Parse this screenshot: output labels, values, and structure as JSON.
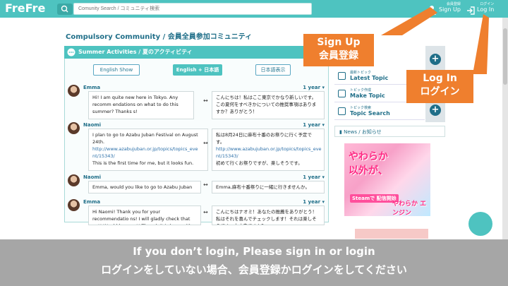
{
  "app": {
    "logo": "FreFre"
  },
  "search": {
    "placeholder": "Comunity Search / コミュニティ検索"
  },
  "nav": {
    "signup_small": "会員登録",
    "signup_label": "Sign Up",
    "login_small": "ログイン",
    "login_label": "Log In"
  },
  "community": {
    "title": "Compulsory Community / 会員全員参加コミュニティ"
  },
  "activity": {
    "header": "Summer Activities / 夏のアクティビティ",
    "lang_buttons": [
      "English Show",
      "English + 日本語",
      "日本語表示"
    ]
  },
  "posts": [
    {
      "user": "Emma",
      "age": "1 year",
      "en": "Hi! I am quite new here in Tokyo. Any recomm endations on what to do this summer? Thanks s!",
      "jp": "こんにちは！私はここ東京でかなり新しいです。この夏何をすべきかについての推奨事項はありますか？ありがとう！"
    },
    {
      "user": "Naomi",
      "age": "1 year",
      "en_1": "I plan to go to Azabu Juban Festival on August 24th.",
      "en_link": "http://www.azabujuban.or.jp/topics/topics_eve nt/15343/",
      "en_2": "This is the first time for me, but it looks fun.",
      "jp_1": "私は8月24日に麻布十番のお祭りに行く予定です。",
      "jp_link": "http://www.azabujuban.or.jp/topics/topics_eve nt/15343/",
      "jp_2": "初めて行くお祭りですが、楽しそうです。"
    },
    {
      "user": "Naomi",
      "age": "1 year",
      "en": "Emma, would you like to go to Azabu Juban ...",
      "jp": "Emma,麻布十番祭りに一緒に行きませんか。"
    },
    {
      "user": "Emma",
      "age": "1 year",
      "en": "Hi Naomi! Thank you for your recommendatio ns! I will gladly check that out! Would be great! Though it is busy with you.",
      "jp": "こんにちはナオミ！あなたの推薦をありがとう！私はそれを喜んでチェックします！それは楽しそうです。大丈夫ですか？"
    }
  ],
  "swap_symbol": "↔",
  "sidebar": {
    "menu": [
      {
        "small": "最新トピック",
        "label": "Latest Topic"
      },
      {
        "small": "トピック作成",
        "label": "Make Topic"
      },
      {
        "small": "トピック検索",
        "label": "Topic Search"
      }
    ],
    "news": "News / お知らせ"
  },
  "ad": {
    "line1": "やわらか",
    "line2": "以外が、",
    "steam": "Steamで 配信開始",
    "brand": "やわらか エンジン"
  },
  "callouts": {
    "signup_en": "Sign Up",
    "signup_jp": "会員登録",
    "login_en": "Log In",
    "login_jp": "ログイン"
  },
  "banner": {
    "line1": "If you don’t login, Please sign in or login",
    "line2": "ログインをしていない場合、会員登録かログインをしてください"
  },
  "colors": {
    "teal": "#4ec3c0",
    "navy": "#1f6e88",
    "orange": "#ef7f2e",
    "gray_banner": "#a6a6a6"
  }
}
